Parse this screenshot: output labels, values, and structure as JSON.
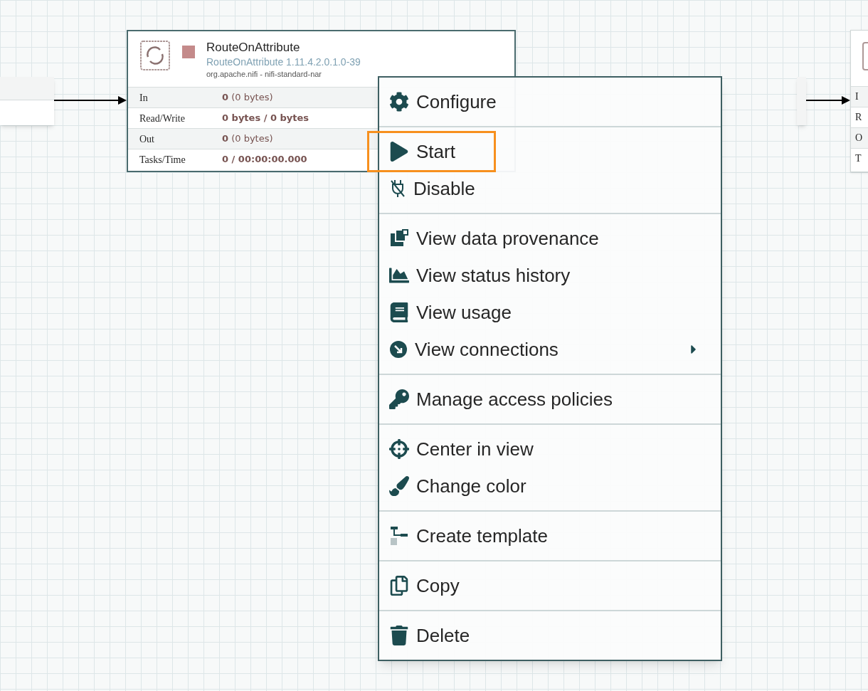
{
  "processor": {
    "name": "RouteOnAttribute",
    "type_version": "RouteOnAttribute 1.11.4.2.0.1.0-39",
    "bundle": "org.apache.nifi - nifi-standard-nar",
    "running": false,
    "stats": [
      {
        "label": "In",
        "value": "**0** (0 bytes)"
      },
      {
        "label": "Read/Write",
        "value": "**0 bytes / 0 bytes**"
      },
      {
        "label": "Out",
        "value": "**0** (0 bytes)"
      },
      {
        "label": "Tasks/Time",
        "value": "**0 / 00:00:00.000**"
      }
    ]
  },
  "right_processor": {
    "stats": [
      {
        "label": "I"
      },
      {
        "label": "R"
      },
      {
        "label": "O"
      },
      {
        "label": "T"
      }
    ]
  },
  "context_menu": {
    "groups": [
      {
        "items": [
          {
            "label": "Configure",
            "highlighted": false,
            "has_submenu": false
          }
        ]
      },
      {
        "items": [
          {
            "label": "Start",
            "highlighted": true,
            "has_submenu": false
          },
          {
            "label": "Disable",
            "highlighted": false,
            "has_submenu": false
          }
        ]
      },
      {
        "items": [
          {
            "label": "View data provenance",
            "highlighted": false,
            "has_submenu": false
          },
          {
            "label": "View status history",
            "highlighted": false,
            "has_submenu": false
          },
          {
            "label": "View usage",
            "highlighted": false,
            "has_submenu": false
          },
          {
            "label": "View connections",
            "highlighted": false,
            "has_submenu": true
          }
        ]
      },
      {
        "items": [
          {
            "label": "Manage access policies",
            "highlighted": false,
            "has_submenu": false
          }
        ]
      },
      {
        "items": [
          {
            "label": "Center in view",
            "highlighted": false,
            "has_submenu": false
          },
          {
            "label": "Change color",
            "highlighted": false,
            "has_submenu": false
          }
        ]
      },
      {
        "items": [
          {
            "label": "Create template",
            "highlighted": false,
            "has_submenu": false
          }
        ]
      },
      {
        "items": [
          {
            "label": "Copy",
            "highlighted": false,
            "has_submenu": false
          }
        ]
      },
      {
        "items": [
          {
            "label": "Delete",
            "highlighted": false,
            "has_submenu": false
          }
        ]
      }
    ]
  }
}
